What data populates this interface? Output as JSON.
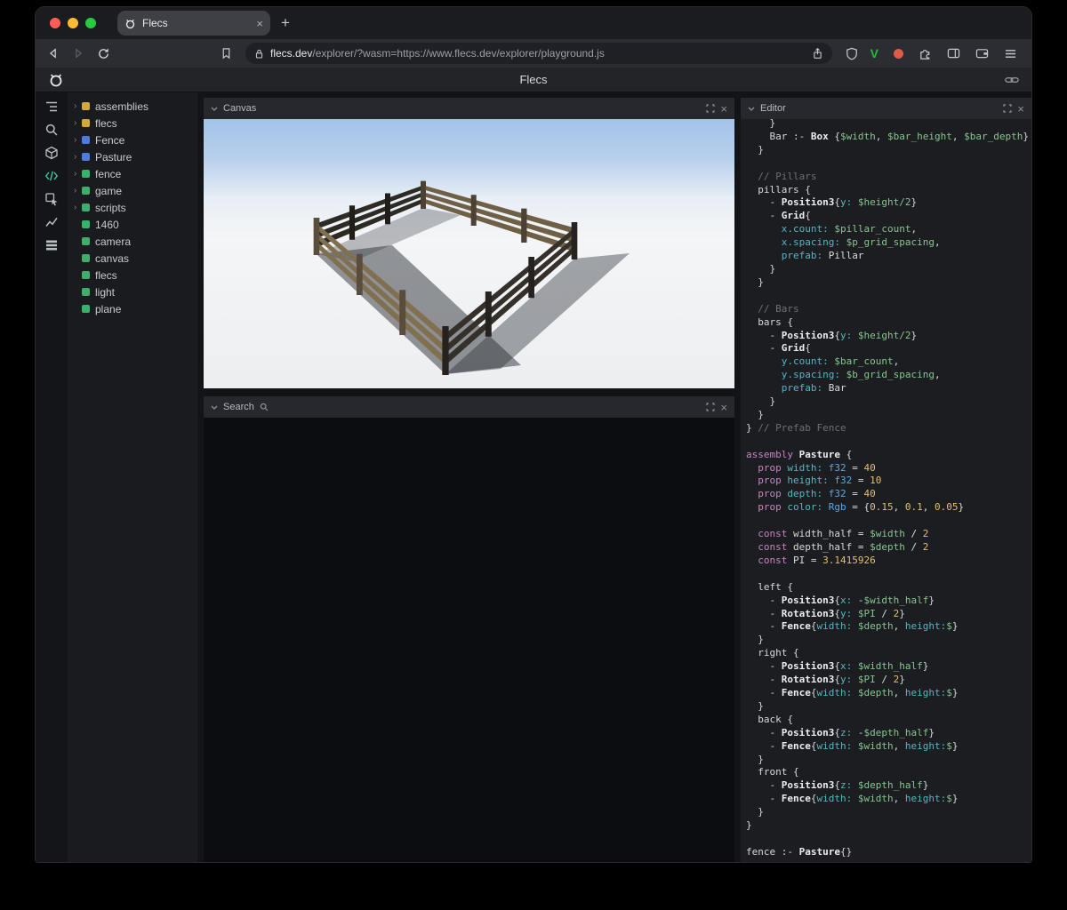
{
  "colors": {
    "accent": "#41c7a7",
    "traffic_red": "#ff5f57",
    "traffic_yellow": "#febc2e",
    "traffic_green": "#28c840",
    "tree_yellow": "#d2a83f",
    "tree_blue": "#4f7bd9",
    "tree_green": "#3fae6a",
    "syn_keyword": "#c586c0",
    "syn_type": "#5fa8e0",
    "syn_var": "#87c58f",
    "syn_num": "#e2c06c",
    "syn_comment": "#6b7178",
    "syn_prop": "#56b6c2"
  },
  "browser": {
    "tab_title": "Flecs",
    "url_host": "flecs.dev",
    "url_rest": "/explorer/?wasm=https://www.flecs.dev/explorer/playground.js",
    "new_tab_label": "+",
    "tab_close_label": "×",
    "icons": [
      "back-icon",
      "forward-icon",
      "reload-icon",
      "bookmark-icon",
      "lock-icon",
      "share-icon",
      "shield-icon",
      "vpn-v-icon",
      "record-dot-icon",
      "extensions-icon",
      "sidebar-toggle-icon",
      "wallet-icon",
      "menu-icon"
    ],
    "vpn_label": "V"
  },
  "header": {
    "title": "Flecs"
  },
  "rail": {
    "icons": [
      "tree-icon",
      "search-icon",
      "cube-icon",
      "code-icon",
      "inspect-icon",
      "chart-icon",
      "rows-icon"
    ]
  },
  "tree": {
    "items": [
      {
        "label": "assemblies",
        "color": "yellow",
        "expandable": true
      },
      {
        "label": "flecs",
        "color": "yellow",
        "expandable": true
      },
      {
        "label": "Fence",
        "color": "blue",
        "expandable": true
      },
      {
        "label": "Pasture",
        "color": "blue",
        "expandable": true
      },
      {
        "label": "fence",
        "color": "green",
        "expandable": true
      },
      {
        "label": "game",
        "color": "green",
        "expandable": true
      },
      {
        "label": "scripts",
        "color": "green",
        "expandable": true
      },
      {
        "label": "1460",
        "color": "green",
        "expandable": false
      },
      {
        "label": "camera",
        "color": "green",
        "expandable": false
      },
      {
        "label": "canvas",
        "color": "green",
        "expandable": false
      },
      {
        "label": "flecs",
        "color": "green",
        "expandable": false
      },
      {
        "label": "light",
        "color": "green",
        "expandable": false
      },
      {
        "label": "plane",
        "color": "green",
        "expandable": false
      }
    ]
  },
  "panels": {
    "canvas": {
      "title": "Canvas",
      "close_label": "×"
    },
    "search": {
      "title": "Search",
      "close_label": "×"
    },
    "editor": {
      "title": "Editor",
      "close_label": "×"
    }
  },
  "code": {
    "lines": [
      [
        [
          "t",
          "    }"
        ]
      ],
      [
        [
          "t",
          "    Bar :- "
        ],
        [
          "b",
          "Box"
        ],
        [
          "t",
          " {"
        ],
        [
          "v",
          "$width"
        ],
        [
          "t",
          ", "
        ],
        [
          "v",
          "$bar_height"
        ],
        [
          "t",
          ", "
        ],
        [
          "v",
          "$bar_depth"
        ],
        [
          "t",
          "}"
        ]
      ],
      [
        [
          "t",
          "  }"
        ]
      ],
      [],
      [
        [
          "c",
          "  // Pillars"
        ]
      ],
      [
        [
          "t",
          "  pillars {"
        ]
      ],
      [
        [
          "t",
          "    - "
        ],
        [
          "b",
          "Position3"
        ],
        [
          "t",
          "{"
        ],
        [
          "p",
          "y:"
        ],
        [
          "t",
          " "
        ],
        [
          "v",
          "$height/2"
        ],
        [
          "t",
          "}"
        ]
      ],
      [
        [
          "t",
          "    - "
        ],
        [
          "b",
          "Grid"
        ],
        [
          "t",
          "{"
        ]
      ],
      [
        [
          "t",
          "      "
        ],
        [
          "p",
          "x.count:"
        ],
        [
          "t",
          " "
        ],
        [
          "v",
          "$pillar_count"
        ],
        [
          "t",
          ","
        ]
      ],
      [
        [
          "t",
          "      "
        ],
        [
          "p",
          "x.spacing:"
        ],
        [
          "t",
          " "
        ],
        [
          "v",
          "$p_grid_spacing"
        ],
        [
          "t",
          ","
        ]
      ],
      [
        [
          "t",
          "      "
        ],
        [
          "p",
          "prefab:"
        ],
        [
          "t",
          " Pillar"
        ]
      ],
      [
        [
          "t",
          "    }"
        ]
      ],
      [
        [
          "t",
          "  }"
        ]
      ],
      [],
      [
        [
          "c",
          "  // Bars"
        ]
      ],
      [
        [
          "t",
          "  bars {"
        ]
      ],
      [
        [
          "t",
          "    - "
        ],
        [
          "b",
          "Position3"
        ],
        [
          "t",
          "{"
        ],
        [
          "p",
          "y:"
        ],
        [
          "t",
          " "
        ],
        [
          "v",
          "$height/2"
        ],
        [
          "t",
          "}"
        ]
      ],
      [
        [
          "t",
          "    - "
        ],
        [
          "b",
          "Grid"
        ],
        [
          "t",
          "{"
        ]
      ],
      [
        [
          "t",
          "      "
        ],
        [
          "p",
          "y.count:"
        ],
        [
          "t",
          " "
        ],
        [
          "v",
          "$bar_count"
        ],
        [
          "t",
          ","
        ]
      ],
      [
        [
          "t",
          "      "
        ],
        [
          "p",
          "y.spacing:"
        ],
        [
          "t",
          " "
        ],
        [
          "v",
          "$b_grid_spacing"
        ],
        [
          "t",
          ","
        ]
      ],
      [
        [
          "t",
          "      "
        ],
        [
          "p",
          "prefab:"
        ],
        [
          "t",
          " Bar"
        ]
      ],
      [
        [
          "t",
          "    }"
        ]
      ],
      [
        [
          "t",
          "  }"
        ]
      ],
      [
        [
          "t",
          "} "
        ],
        [
          "c",
          "// Prefab Fence"
        ]
      ],
      [],
      [
        [
          "k",
          "assembly"
        ],
        [
          "t",
          " "
        ],
        [
          "b",
          "Pasture"
        ],
        [
          "t",
          " {"
        ]
      ],
      [
        [
          "t",
          "  "
        ],
        [
          "k",
          "prop"
        ],
        [
          "t",
          " "
        ],
        [
          "p",
          "width:"
        ],
        [
          "t",
          " "
        ],
        [
          "y",
          "f32"
        ],
        [
          "t",
          " = "
        ],
        [
          "n",
          "40"
        ]
      ],
      [
        [
          "t",
          "  "
        ],
        [
          "k",
          "prop"
        ],
        [
          "t",
          " "
        ],
        [
          "p",
          "height:"
        ],
        [
          "t",
          " "
        ],
        [
          "y",
          "f32"
        ],
        [
          "t",
          " = "
        ],
        [
          "n",
          "10"
        ]
      ],
      [
        [
          "t",
          "  "
        ],
        [
          "k",
          "prop"
        ],
        [
          "t",
          " "
        ],
        [
          "p",
          "depth:"
        ],
        [
          "t",
          " "
        ],
        [
          "y",
          "f32"
        ],
        [
          "t",
          " = "
        ],
        [
          "n",
          "40"
        ]
      ],
      [
        [
          "t",
          "  "
        ],
        [
          "k",
          "prop"
        ],
        [
          "t",
          " "
        ],
        [
          "p",
          "color:"
        ],
        [
          "t",
          " "
        ],
        [
          "y",
          "Rgb"
        ],
        [
          "t",
          " = {"
        ],
        [
          "n",
          "0.15"
        ],
        [
          "t",
          ", "
        ],
        [
          "n",
          "0.1"
        ],
        [
          "t",
          ", "
        ],
        [
          "n",
          "0.05"
        ],
        [
          "t",
          "}"
        ]
      ],
      [],
      [
        [
          "t",
          "  "
        ],
        [
          "k",
          "const"
        ],
        [
          "t",
          " width_half = "
        ],
        [
          "v",
          "$width"
        ],
        [
          "t",
          " / "
        ],
        [
          "n",
          "2"
        ]
      ],
      [
        [
          "t",
          "  "
        ],
        [
          "k",
          "const"
        ],
        [
          "t",
          " depth_half = "
        ],
        [
          "v",
          "$depth"
        ],
        [
          "t",
          " / "
        ],
        [
          "n",
          "2"
        ]
      ],
      [
        [
          "t",
          "  "
        ],
        [
          "k",
          "const"
        ],
        [
          "t",
          " PI = "
        ],
        [
          "n",
          "3.1415926"
        ]
      ],
      [],
      [
        [
          "t",
          "  left {"
        ]
      ],
      [
        [
          "t",
          "    - "
        ],
        [
          "b",
          "Position3"
        ],
        [
          "t",
          "{"
        ],
        [
          "p",
          "x:"
        ],
        [
          "t",
          " -"
        ],
        [
          "v",
          "$width_half"
        ],
        [
          "t",
          "}"
        ]
      ],
      [
        [
          "t",
          "    - "
        ],
        [
          "b",
          "Rotation3"
        ],
        [
          "t",
          "{"
        ],
        [
          "p",
          "y:"
        ],
        [
          "t",
          " "
        ],
        [
          "v",
          "$PI"
        ],
        [
          "t",
          " / "
        ],
        [
          "n",
          "2"
        ],
        [
          "t",
          "}"
        ]
      ],
      [
        [
          "t",
          "    - "
        ],
        [
          "b",
          "Fence"
        ],
        [
          "t",
          "{"
        ],
        [
          "p",
          "width:"
        ],
        [
          "t",
          " "
        ],
        [
          "v",
          "$depth"
        ],
        [
          "t",
          ", "
        ],
        [
          "p",
          "height:"
        ],
        [
          "v",
          "$"
        ],
        [
          "t",
          "}"
        ]
      ],
      [
        [
          "t",
          "  }"
        ]
      ],
      [
        [
          "t",
          "  right {"
        ]
      ],
      [
        [
          "t",
          "    - "
        ],
        [
          "b",
          "Position3"
        ],
        [
          "t",
          "{"
        ],
        [
          "p",
          "x:"
        ],
        [
          "t",
          " "
        ],
        [
          "v",
          "$width_half"
        ],
        [
          "t",
          "}"
        ]
      ],
      [
        [
          "t",
          "    - "
        ],
        [
          "b",
          "Rotation3"
        ],
        [
          "t",
          "{"
        ],
        [
          "p",
          "y:"
        ],
        [
          "t",
          " "
        ],
        [
          "v",
          "$PI"
        ],
        [
          "t",
          " / "
        ],
        [
          "n",
          "2"
        ],
        [
          "t",
          "}"
        ]
      ],
      [
        [
          "t",
          "    - "
        ],
        [
          "b",
          "Fence"
        ],
        [
          "t",
          "{"
        ],
        [
          "p",
          "width:"
        ],
        [
          "t",
          " "
        ],
        [
          "v",
          "$depth"
        ],
        [
          "t",
          ", "
        ],
        [
          "p",
          "height:"
        ],
        [
          "v",
          "$"
        ],
        [
          "t",
          "}"
        ]
      ],
      [
        [
          "t",
          "  }"
        ]
      ],
      [
        [
          "t",
          "  back {"
        ]
      ],
      [
        [
          "t",
          "    - "
        ],
        [
          "b",
          "Position3"
        ],
        [
          "t",
          "{"
        ],
        [
          "p",
          "z:"
        ],
        [
          "t",
          " -"
        ],
        [
          "v",
          "$depth_half"
        ],
        [
          "t",
          "}"
        ]
      ],
      [
        [
          "t",
          "    - "
        ],
        [
          "b",
          "Fence"
        ],
        [
          "t",
          "{"
        ],
        [
          "p",
          "width:"
        ],
        [
          "t",
          " "
        ],
        [
          "v",
          "$width"
        ],
        [
          "t",
          ", "
        ],
        [
          "p",
          "height:"
        ],
        [
          "v",
          "$"
        ],
        [
          "t",
          "}"
        ]
      ],
      [
        [
          "t",
          "  }"
        ]
      ],
      [
        [
          "t",
          "  front {"
        ]
      ],
      [
        [
          "t",
          "    - "
        ],
        [
          "b",
          "Position3"
        ],
        [
          "t",
          "{"
        ],
        [
          "p",
          "z:"
        ],
        [
          "t",
          " "
        ],
        [
          "v",
          "$depth_half"
        ],
        [
          "t",
          "}"
        ]
      ],
      [
        [
          "t",
          "    - "
        ],
        [
          "b",
          "Fence"
        ],
        [
          "t",
          "{"
        ],
        [
          "p",
          "width:"
        ],
        [
          "t",
          " "
        ],
        [
          "v",
          "$width"
        ],
        [
          "t",
          ", "
        ],
        [
          "p",
          "height:"
        ],
        [
          "v",
          "$"
        ],
        [
          "t",
          "}"
        ]
      ],
      [
        [
          "t",
          "  }"
        ]
      ],
      [
        [
          "t",
          "}"
        ]
      ],
      [],
      [
        [
          "t",
          "fence :- "
        ],
        [
          "b",
          "Pasture"
        ],
        [
          "t",
          "{}"
        ]
      ]
    ]
  }
}
